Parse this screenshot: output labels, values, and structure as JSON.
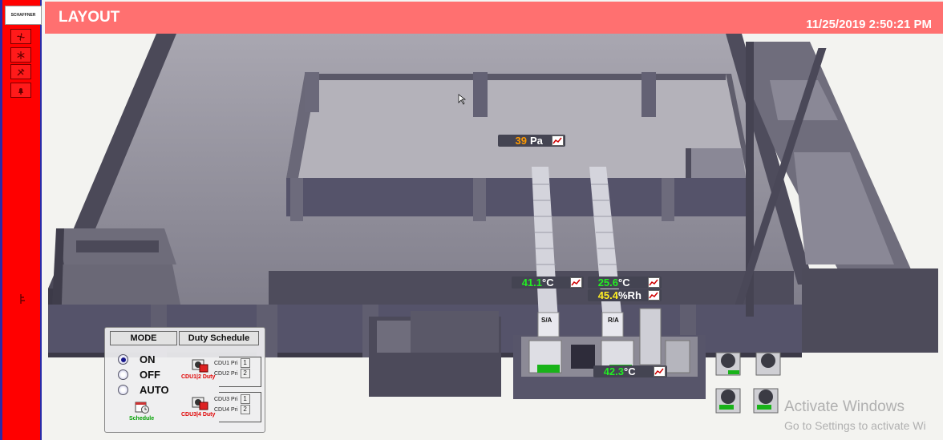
{
  "header": {
    "title": "LAYOUT",
    "datetime": "11/25/2019 2:50:21 PM"
  },
  "sidebar": {
    "logo": "SCHAFFNER",
    "buttons": [
      {
        "icon": "fan-icon"
      },
      {
        "icon": "snowflake-icon"
      },
      {
        "icon": "tools-icon"
      },
      {
        "icon": "alarm-icon"
      }
    ],
    "side_icon": "tag-icon"
  },
  "readings": {
    "pressure": {
      "value": "39",
      "unit": "Pa",
      "color": "#ff9a00"
    },
    "supply_temp": {
      "value": "41.1",
      "unit": "°C",
      "color": "#22ee22"
    },
    "return_temp": {
      "value": "25.6",
      "unit": "°C",
      "color": "#22ee22"
    },
    "return_rh": {
      "value": "45.4",
      "unit": "%Rh",
      "color": "#ffee22"
    },
    "plant_temp": {
      "value": "42.3",
      "unit": "°C",
      "color": "#22ee22"
    }
  },
  "ducts": {
    "supply": "S/A",
    "return": "R/A"
  },
  "control_panel": {
    "mode_label": "MODE",
    "duty_label": "Duty Schedule",
    "modes": [
      {
        "label": "ON",
        "selected": true
      },
      {
        "label": "OFF",
        "selected": false
      },
      {
        "label": "AUTO",
        "selected": false
      }
    ],
    "groups": [
      {
        "duty": "CDU1|2 Duty",
        "rows": [
          {
            "name": "CDU1 Pri",
            "num": "1"
          },
          {
            "name": "CDU2 Pri",
            "num": "2"
          }
        ]
      },
      {
        "duty": "CDU3|4 Duty",
        "rows": [
          {
            "name": "CDU3 Pri",
            "num": "1"
          },
          {
            "name": "CDU4 Pri",
            "num": "2"
          }
        ]
      }
    ],
    "schedule_label": "Schedule"
  },
  "watermark": {
    "line1": "Activate Windows",
    "line2": "Go to Settings to activate Wi"
  },
  "colors": {
    "sidebar": "#ff0000",
    "header": "#ff7070",
    "walls": "#55536a",
    "floor": "#8e8c98"
  }
}
